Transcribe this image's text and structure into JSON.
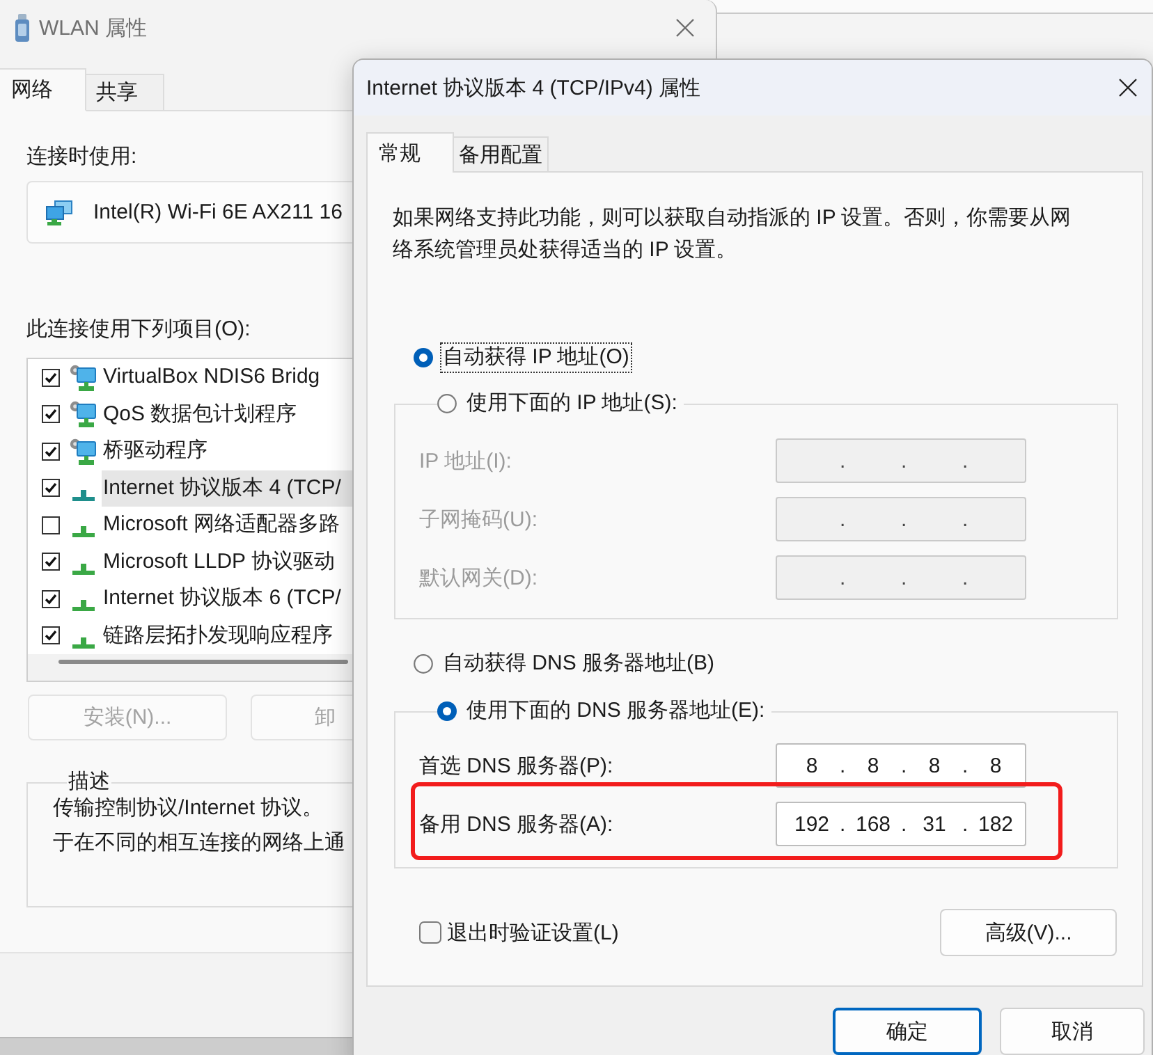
{
  "wlan_window": {
    "title": "WLAN 属性",
    "tabs": [
      {
        "label": "网络",
        "selected": true
      },
      {
        "label": "共享",
        "selected": false
      }
    ],
    "connect_using": {
      "label": "连接时使用:",
      "adapter": "Intel(R) Wi-Fi 6E AX211 16"
    },
    "items_label": "此连接使用下列项目(O):",
    "items": [
      {
        "label": "VirtualBox NDIS6 Bridg",
        "kind": "service",
        "checked": true,
        "selected": false
      },
      {
        "label": "QoS 数据包计划程序",
        "kind": "service",
        "checked": true,
        "selected": false
      },
      {
        "label": "桥驱动程序",
        "kind": "service",
        "checked": true,
        "selected": false
      },
      {
        "label": "Internet 协议版本 4 (TCP/",
        "kind": "protocol",
        "checked": true,
        "selected": true
      },
      {
        "label": "Microsoft 网络适配器多路",
        "kind": "protocol",
        "checked": false,
        "selected": false
      },
      {
        "label": "Microsoft LLDP 协议驱动",
        "kind": "protocol",
        "checked": true,
        "selected": false
      },
      {
        "label": "Internet 协议版本 6 (TCP/",
        "kind": "protocol",
        "checked": true,
        "selected": false
      },
      {
        "label": "链路层拓扑发现响应程序",
        "kind": "protocol",
        "checked": true,
        "selected": false
      }
    ],
    "buttons": [
      {
        "label": "安装(N)...",
        "disabled": true
      },
      {
        "label": "卸",
        "disabled": true
      }
    ],
    "description": {
      "title": "描述",
      "lines": [
        "传输控制协议/Internet 协议。",
        "于在不同的相互连接的网络上通"
      ]
    }
  },
  "ipv4_dialog": {
    "title": "Internet 协议版本 4 (TCP/IPv4) 属性",
    "tabs": [
      {
        "label": "常规",
        "selected": true
      },
      {
        "label": "备用配置",
        "selected": false
      }
    ],
    "intro": "如果网络支持此功能，则可以获取自动指派的 IP 设置。否则，你需要从网络系统管理员处获得适当的 IP 设置。",
    "ip_settings": {
      "auto": {
        "label": "自动获得 IP 地址(O)",
        "selected": true,
        "focused": true
      },
      "manual": {
        "label": "使用下面的 IP 地址(S):",
        "selected": false,
        "focused": false,
        "disabled": true,
        "fields": [
          {
            "label": "IP 地址(I):",
            "value": ". . ."
          },
          {
            "label": "子网掩码(U):",
            "value": ". . ."
          },
          {
            "label": "默认网关(D):",
            "value": ". . ."
          }
        ]
      }
    },
    "dns_settings": {
      "auto": {
        "label": "自动获得 DNS 服务器地址(B)",
        "selected": false,
        "focused": false
      },
      "manual": {
        "label": "使用下面的 DNS 服务器地址(E):",
        "selected": true,
        "focused": false,
        "disabled": false,
        "fields": [
          {
            "label": "首选 DNS 服务器(P):",
            "value": "8 . 8 . 8 . 8",
            "highlighted": false
          },
          {
            "label": "备用 DNS 服务器(A):",
            "value": "192 . 168 . 31 . 182",
            "highlighted": true
          }
        ]
      }
    },
    "validate_on_exit": {
      "label": "退出时验证设置(L)",
      "checked": false
    },
    "advanced_button": "高级(V)...",
    "buttons": [
      {
        "label": "确定",
        "default": true
      },
      {
        "label": "取消",
        "default": false
      }
    ]
  }
}
